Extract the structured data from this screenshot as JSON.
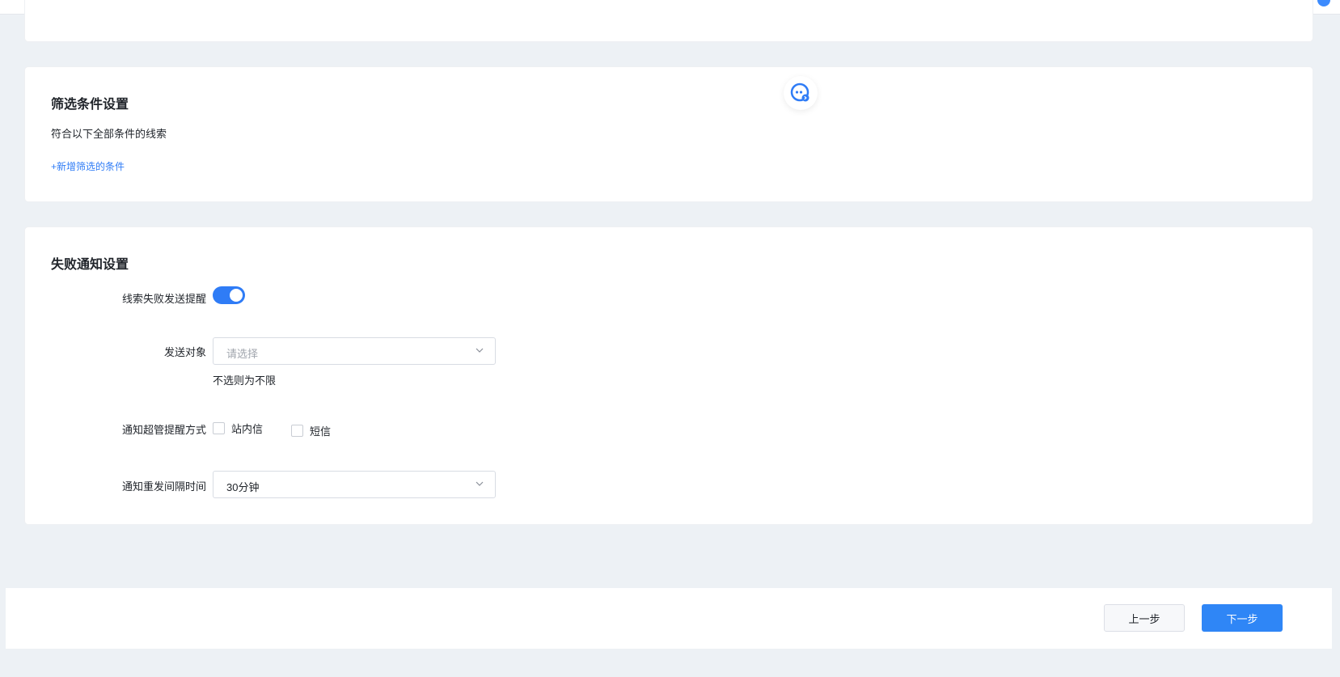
{
  "filter_section": {
    "title": "筛选条件设置",
    "match_text": "符合以下全部条件的线索",
    "add_condition_label": "+新增筛选的条件"
  },
  "notify_section": {
    "title": "失败通知设置",
    "reminder_label": "线索失败发送提醒",
    "reminder_enabled": true,
    "target_label": "发送对象",
    "target_placeholder": "请选择",
    "target_hint": "不选则为不限",
    "method_label": "通知超管提醒方式",
    "method_options": [
      {
        "label": "站内信",
        "checked": false
      },
      {
        "label": "短信",
        "checked": false
      }
    ],
    "interval_label": "通知重发间隔时间",
    "interval_value": "30分钟"
  },
  "footer": {
    "prev_label": "上一步",
    "next_label": "下一步"
  },
  "colors": {
    "accent": "#2f7cf6",
    "page_bg": "#edf1f5"
  }
}
